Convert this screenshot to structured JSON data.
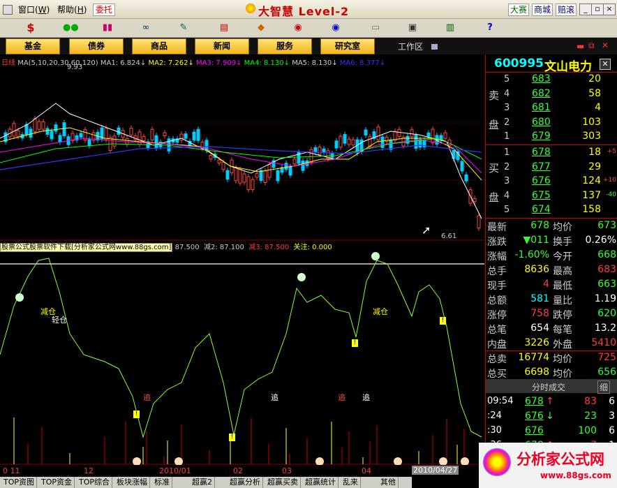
{
  "menu": {
    "window": "窗口",
    "window_key": "W",
    "help": "帮助",
    "help_key": "H",
    "entrust": "委托"
  },
  "title": "大智慧 Level-2",
  "top_links": [
    "大赛",
    "商城",
    "赔滚"
  ],
  "toolbar_icons": [
    "dollar-icon",
    "traffic-light-icon",
    "bars-icon",
    "binoculars-icon",
    "broom-icon",
    "chart-icon",
    "diamond-icon",
    "disc-red-icon",
    "disc-blue-icon",
    "book-icon",
    "window-icon",
    "books-icon",
    "help-cursor-icon"
  ],
  "categories": [
    "基金",
    "债券",
    "商品",
    "新闻",
    "服务",
    "研究室"
  ],
  "workarea": "工作区",
  "ma_header": {
    "period": "日线",
    "ma_params": "MA(5,10,20,30,60,120)",
    "ma1": "MA1: 6.824↓",
    "ma2": "MA2: 7.262↓",
    "ma3": "MA3: 7.909↓",
    "ma4": "MA4: 8.130↓",
    "ma5": "MA5: 8.130↓",
    "ma6": "MA6: 8.377↓"
  },
  "price_labels": {
    "high": "9.93",
    "low": "6.61"
  },
  "indicator_header": {
    "source": "股票公式股票软件下载[分析家公式网www.88gs.com]",
    "v1": "87.500",
    "v2_label": "减2:",
    "v2": "87.100",
    "v3_label": "减3:",
    "v3": "87.500",
    "focus_label": "关注:",
    "focus": "0.000"
  },
  "signals": {
    "reduce": "减仓",
    "light": "轻仓",
    "chase": "追"
  },
  "date_axis": [
    "0 11",
    "12",
    "2010/01",
    "02",
    "03",
    "04",
    "2010/04/27"
  ],
  "stock": {
    "code": "600995",
    "name": "文山电力"
  },
  "sell_side_label": [
    "卖",
    "盘"
  ],
  "buy_side_label": [
    "买",
    "盘"
  ],
  "sell_orders": [
    {
      "lvl": "5",
      "price": "683",
      "vol": "20",
      "chg": ""
    },
    {
      "lvl": "4",
      "price": "682",
      "vol": "58",
      "chg": ""
    },
    {
      "lvl": "3",
      "price": "681",
      "vol": "4",
      "chg": ""
    },
    {
      "lvl": "2",
      "price": "680",
      "vol": "103",
      "chg": ""
    },
    {
      "lvl": "1",
      "price": "679",
      "vol": "303",
      "chg": ""
    }
  ],
  "buy_orders": [
    {
      "lvl": "1",
      "price": "678",
      "vol": "18",
      "chg": "+5"
    },
    {
      "lvl": "2",
      "price": "677",
      "vol": "29",
      "chg": ""
    },
    {
      "lvl": "3",
      "price": "676",
      "vol": "124",
      "chg": "+10"
    },
    {
      "lvl": "4",
      "price": "675",
      "vol": "137",
      "chg": "-40"
    },
    {
      "lvl": "5",
      "price": "674",
      "vol": "158",
      "chg": ""
    }
  ],
  "quote": {
    "latest_label": "最新",
    "latest": "678",
    "avg_label": "均价",
    "avg": "673",
    "change_label": "涨跌",
    "change": "▼011",
    "turnover_label": "换手",
    "turnover": "0.26%",
    "pct_label": "涨幅",
    "pct": "-1.60%",
    "open_label": "今开",
    "open": "668",
    "total_vol_label": "总手",
    "total_vol": "8636",
    "high_label": "最高",
    "high": "683",
    "cur_vol_label": "现手",
    "cur_vol": "4",
    "low_label": "最低",
    "low": "663",
    "amount_label": "总额",
    "amount": "581",
    "ratio_label": "量比",
    "ratio": "1.19",
    "limit_up_label": "涨停",
    "limit_up": "758",
    "limit_down_label": "跌停",
    "limit_down": "620",
    "trades_label": "总笔",
    "trades": "654",
    "per_trade_label": "每笔",
    "per_trade": "13.2",
    "inner_label": "内盘",
    "inner": "3226",
    "outer_label": "外盘",
    "outer": "5410",
    "sell_total_label": "总卖",
    "sell_total": "16774",
    "sell_avg_label": "均价",
    "sell_avg": "725",
    "buy_total_label": "总买",
    "buy_total": "6698",
    "buy_avg_label": "均价",
    "buy_avg": "656"
  },
  "ticks_header": {
    "title": "分时成交",
    "mode": "细"
  },
  "ticks": [
    {
      "time": "09:54",
      "price": "678",
      "arrow": "↑",
      "vol": "83",
      "n": "6"
    },
    {
      "time": ":24",
      "price": "676",
      "arrow": "↓",
      "vol": "23",
      "n": "3"
    },
    {
      "time": ":30",
      "price": "676",
      "arrow": "",
      "vol": "100",
      "n": "6"
    },
    {
      "time": ":36",
      "price": "678",
      "arrow": "↑",
      "vol": "7",
      "n": "1"
    }
  ],
  "bottom_tabs": [
    "TOP资图",
    "TOP资金",
    "TOP综合",
    "板块涨幅",
    "标准",
    "超赢2",
    "超赢分析",
    "超赢买卖",
    "超赢统计",
    "乱来",
    "其他"
  ],
  "watermark": {
    "name": "分析家公式网",
    "url": "www.88gs.com"
  }
}
